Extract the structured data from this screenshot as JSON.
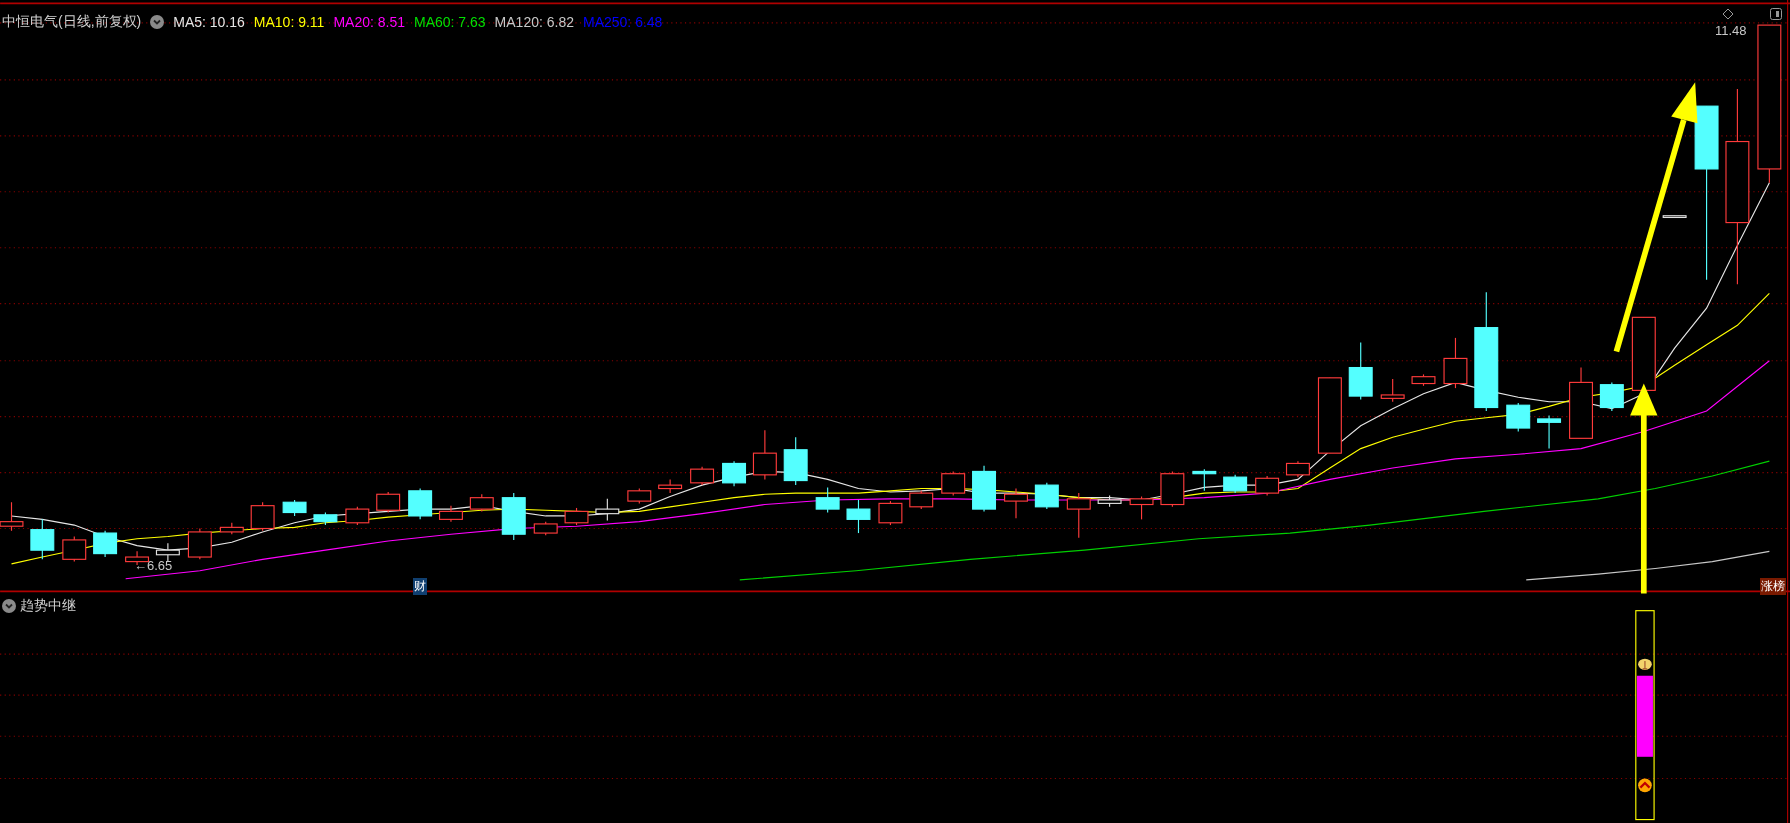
{
  "title": "中恒电气(日线,前复权)",
  "moving_averages": [
    {
      "label": "MA5: 10.16",
      "color": "#e6e6e6"
    },
    {
      "label": "MA10: 9.11",
      "color": "#ffff00"
    },
    {
      "label": "MA20: 8.51",
      "color": "#ff00ff"
    },
    {
      "label": "MA60: 7.63",
      "color": "#00e000"
    },
    {
      "label": "MA120: 6.82",
      "color": "#c8c8c8"
    },
    {
      "label": "MA250: 6.48",
      "color": "#0000ff"
    }
  ],
  "price_marks": {
    "high": "11.48",
    "low": "←6.65"
  },
  "badges": [
    {
      "kind": "finance",
      "text": "财"
    },
    {
      "kind": "ranking",
      "text": "涨榜"
    }
  ],
  "indicator": {
    "title": "趋势中继"
  }
}
